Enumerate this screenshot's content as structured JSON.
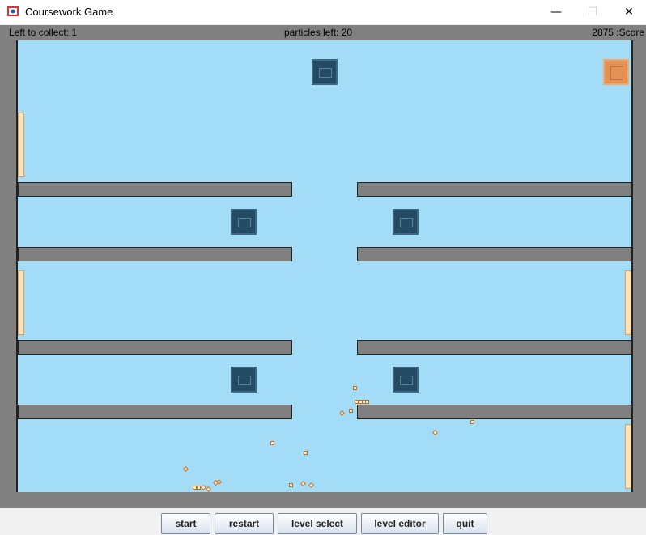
{
  "window": {
    "title": "Coursework Game",
    "minimize_glyph": "—",
    "maximize_glyph": "☐",
    "close_glyph": "✕"
  },
  "status": {
    "left_to_collect": "Left to collect: 1",
    "particles_left": "particles left: 20",
    "score": "2875 :Score"
  },
  "buttons": {
    "start": "start",
    "restart": "restart",
    "level_select": "level select",
    "level_editor": "level editor",
    "quit": "quit"
  },
  "colors": {
    "field": "#a3dcf7",
    "platform": "#808080",
    "enemy": "#244a64",
    "goal": "#e49155",
    "collectible": "#fde3be",
    "particle": "#c46a1f"
  }
}
